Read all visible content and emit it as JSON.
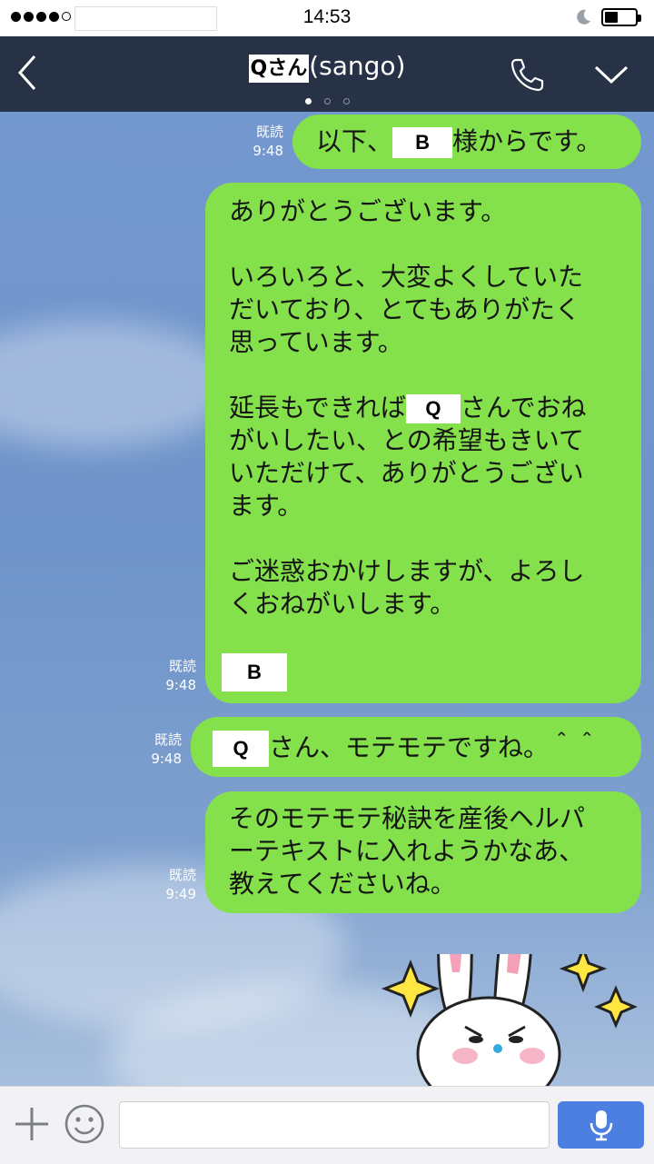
{
  "status_bar": {
    "time": "14:53"
  },
  "header": {
    "name_masked": "Qさん",
    "name_suffix": "(sango)"
  },
  "messages": [
    {
      "read": "既読",
      "time": "9:48",
      "parts": [
        "以下、",
        "B",
        "様からです。"
      ]
    },
    {
      "read": "既読",
      "time": "9:48",
      "lines": [
        "ありがとうございます。",
        "",
        "いろいろと、大変よくしていた",
        "だいており、とてもありがたく",
        "思っています。",
        ""
      ],
      "line7_parts": [
        "延長もできれば",
        "Q",
        "さんでおね"
      ],
      "lines2": [
        "がいしたい、との希望もきいて",
        "いただけて、ありがとうござい",
        "ます。",
        "",
        "ご迷惑おかけしますが、よろし",
        "くおねがいします。"
      ],
      "signature": "B"
    },
    {
      "read": "既読",
      "time": "9:48",
      "parts": [
        "Q",
        "さん、モテモテですね。＾＾"
      ]
    },
    {
      "read": "既読",
      "time": "9:49",
      "lines": [
        "そのモテモテ秘訣を産後ヘルパ",
        "ーテキストに入れようかなあ、",
        "教えてくださいね。"
      ]
    }
  ],
  "input": {
    "placeholder": ""
  },
  "colors": {
    "bubble": "#84e04b",
    "header": "#273246",
    "mic": "#4c7fe0"
  },
  "icons": [
    "back-icon",
    "phone-icon",
    "chevron-down-icon",
    "plus-icon",
    "smiley-icon",
    "microphone-icon",
    "moon-icon",
    "battery-icon"
  ]
}
